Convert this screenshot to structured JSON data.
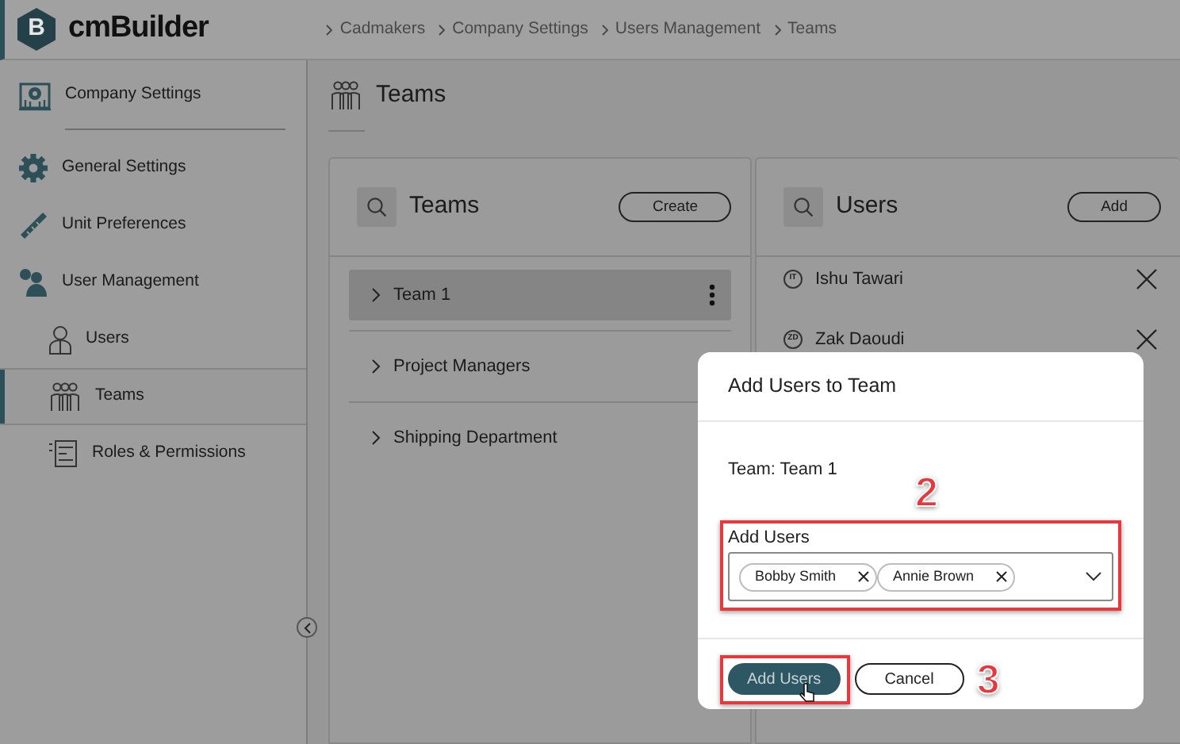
{
  "header": {
    "logo_letter": "B",
    "logo_text": "cmBuilder",
    "breadcrumbs": [
      "Cadmakers",
      "Company Settings",
      "Users Management",
      "Teams"
    ]
  },
  "sidebar": {
    "items": [
      {
        "label": "Company Settings",
        "selected": false
      },
      {
        "label": "General Settings",
        "selected": false
      },
      {
        "label": "Unit Preferences",
        "selected": false
      },
      {
        "label": "User Management",
        "selected": false,
        "children": [
          {
            "label": "Users",
            "selected": false
          },
          {
            "label": "Teams",
            "selected": true
          },
          {
            "label": "Roles & Permissions",
            "selected": false
          }
        ]
      }
    ]
  },
  "page": {
    "title": "Teams"
  },
  "teams_panel": {
    "title": "Teams",
    "button": "Create",
    "items": [
      {
        "label": "Team 1",
        "selected": true
      },
      {
        "label": "Project Managers",
        "selected": false
      },
      {
        "label": "Shipping Department",
        "selected": false
      }
    ]
  },
  "users_panel": {
    "title": "Users",
    "button": "Add",
    "users": [
      {
        "initials": "IT",
        "name": "Ishu Tawari"
      },
      {
        "initials": "ZD",
        "name": "Zak Daoudi"
      }
    ]
  },
  "modal": {
    "title": "Add Users to Team",
    "team_line": "Team: Team 1",
    "field": {
      "label": "Add Users",
      "annotation": "2",
      "chips": [
        "Bobby Smith",
        "Annie Brown"
      ]
    },
    "primary_button": {
      "label": "Add Users",
      "annotation": "3"
    },
    "secondary_button": "Cancel"
  }
}
